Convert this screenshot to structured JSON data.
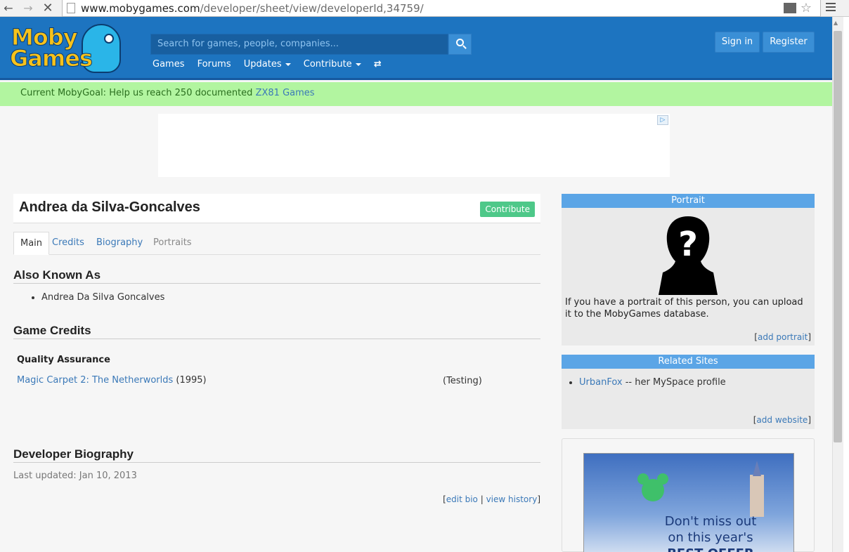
{
  "browser": {
    "url_host": "www.mobygames.com",
    "url_path": "/developer/sheet/view/developerId,34759/"
  },
  "header": {
    "logo_line1": "Moby",
    "logo_line2": "Games",
    "search_placeholder": "Search for games, people, companies...",
    "nav": [
      "Games",
      "Forums",
      "Updates",
      "Contribute"
    ],
    "sign_in": "Sign in",
    "register": "Register"
  },
  "goal": {
    "text": "Current MobyGoal: Help us reach 250 documented",
    "link": "ZX81 Games"
  },
  "main": {
    "name": "Andrea da Silva-Goncalves",
    "contribute": "Contribute",
    "tabs": [
      "Main",
      "Credits",
      "Biography",
      "Portraits"
    ],
    "aka_heading": "Also Known As",
    "aka": [
      "Andrea Da Silva Goncalves"
    ],
    "credits_heading": "Game Credits",
    "credit_role": "Quality Assurance",
    "credit_game": "Magic Carpet 2: The Netherworlds",
    "credit_year": "(1995)",
    "credit_detail": "(Testing)",
    "bio_heading": "Developer Biography",
    "bio_updated": "Last updated: Jan 10, 2013",
    "edit_bio": "edit bio",
    "view_history": "view history"
  },
  "sidebar": {
    "portrait_heading": "Portrait",
    "portrait_text": "If you have a portrait of this person, you can upload it to the MobyGames database.",
    "add_portrait": "add portrait",
    "related_heading": "Related Sites",
    "related_link": "UrbanFox",
    "related_text": " -- her MySpace profile",
    "add_website": "add website",
    "ad_line1": "Don't miss out",
    "ad_line2": "on this year's",
    "ad_line3": "BEST OFFER"
  }
}
